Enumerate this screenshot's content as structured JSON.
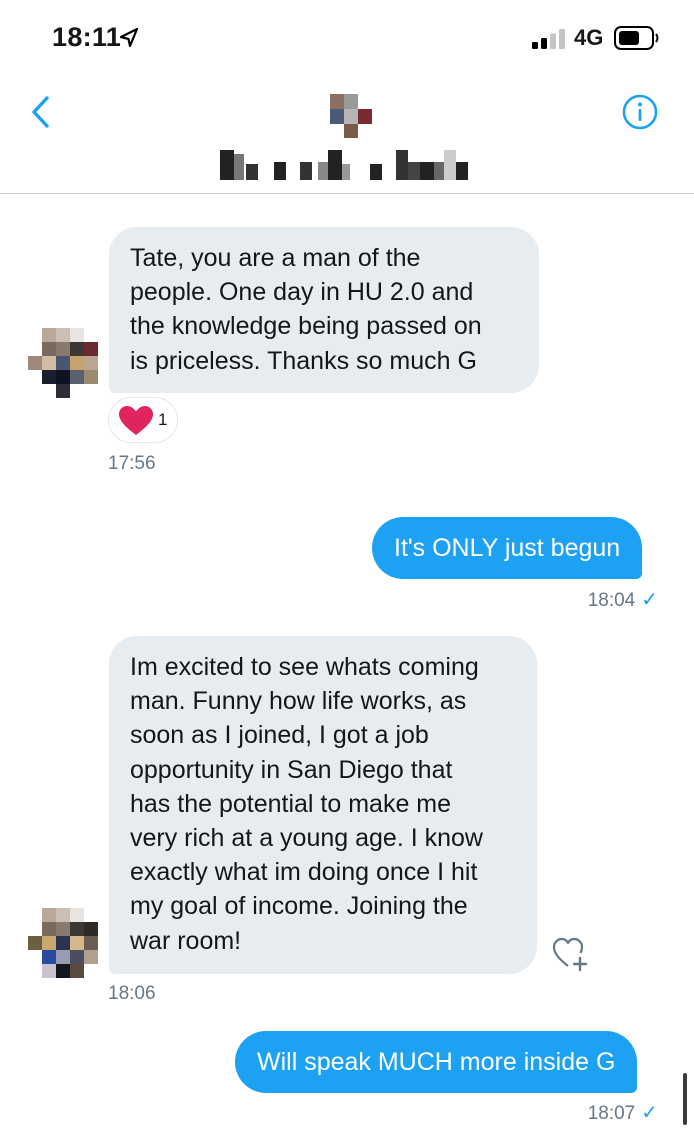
{
  "status_bar": {
    "time": "18:11",
    "network": "4G",
    "icons": [
      "location-arrow-icon",
      "signal-bars-icon",
      "battery-icon"
    ]
  },
  "header": {
    "back_icon": "chevron-left-icon",
    "info_icon": "info-circle-icon",
    "contact_name_obscured": true
  },
  "conversation": {
    "messages": [
      {
        "direction": "incoming",
        "lines": [
          "Tate, you are a man of the",
          "people. One day in HU 2.0 and",
          "the knowledge being passed on",
          "is priceless. Thanks so much G"
        ],
        "reaction": {
          "icon": "heart-icon",
          "count": "1"
        },
        "time": "17:56"
      },
      {
        "direction": "outgoing",
        "text": "It's ONLY just begun",
        "time": "18:04",
        "status_icon": "checkmark-icon"
      },
      {
        "direction": "incoming",
        "lines": [
          "Im excited to see whats coming",
          "man. Funny how life works, as",
          "soon as I joined, I got a job",
          "opportunity in San Diego that",
          "has the potential to make me",
          "very rich at a young age. I know",
          "exactly what im doing once I hit",
          "my goal of income. Joining the",
          "war room!"
        ],
        "like_icon": "heart-plus-icon",
        "time": "18:06"
      },
      {
        "direction": "outgoing",
        "text": "Will speak MUCH more inside G",
        "time": "18:07",
        "status_icon": "checkmark-icon"
      }
    ]
  },
  "colors": {
    "accent": "#1da1f2",
    "incoming_bubble": "#e6ecf0",
    "heart": "#e0245e",
    "muted_text": "#657786"
  }
}
